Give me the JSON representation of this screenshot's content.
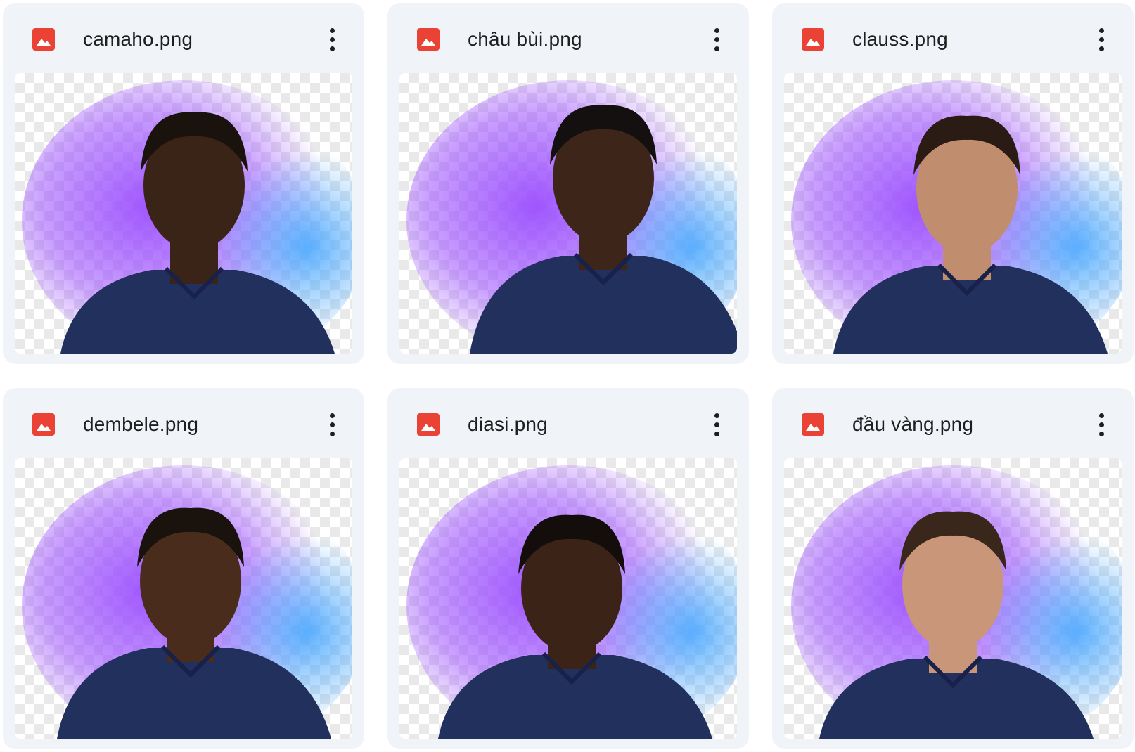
{
  "files": [
    {
      "name": "camaho.png",
      "icon": "image-file-icon",
      "menu_icon": "more-vert-icon",
      "skin": "#3a2418",
      "hair": "#1a120d"
    },
    {
      "name": "châu bùi.png",
      "icon": "image-file-icon",
      "menu_icon": "more-vert-icon",
      "skin": "#3d2519",
      "hair": "#141010"
    },
    {
      "name": "clauss.png",
      "icon": "image-file-icon",
      "menu_icon": "more-vert-icon",
      "skin": "#c08d6e",
      "hair": "#2a1c14"
    },
    {
      "name": "dembele.png",
      "icon": "image-file-icon",
      "menu_icon": "more-vert-icon",
      "skin": "#4a2c1d",
      "hair": "#1a120d"
    },
    {
      "name": "diasi.png",
      "icon": "image-file-icon",
      "menu_icon": "more-vert-icon",
      "skin": "#3b2318",
      "hair": "#130e0b"
    },
    {
      "name": "đầu vàng.png",
      "icon": "image-file-icon",
      "menu_icon": "more-vert-icon",
      "skin": "#c9967a",
      "hair": "#3a271b"
    }
  ],
  "colors": {
    "card_bg": "#f0f4f9",
    "icon_red": "#ea4335",
    "text": "#1f1f1f",
    "jersey": "#22305e",
    "glow_purple": "#9b4dff",
    "glow_blue": "#4aa8ff"
  }
}
